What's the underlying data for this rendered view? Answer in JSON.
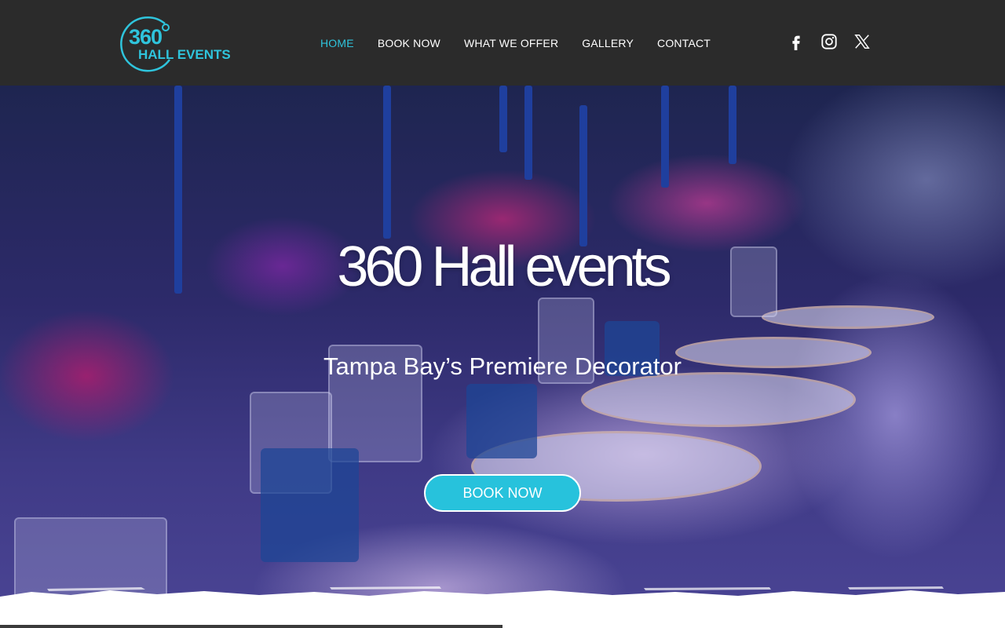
{
  "logo": {
    "number": "360",
    "text": "HALL EVENTS",
    "accent": "#2fc4dc"
  },
  "nav": {
    "items": [
      {
        "label": "HOME",
        "active": true
      },
      {
        "label": "BOOK NOW",
        "active": false
      },
      {
        "label": "WHAT WE OFFER",
        "active": false
      },
      {
        "label": "GALLERY",
        "active": false
      },
      {
        "label": "CONTACT",
        "active": false
      }
    ]
  },
  "social": {
    "icons": [
      "facebook-icon",
      "instagram-icon",
      "x-icon"
    ]
  },
  "hero": {
    "title": "360 Hall events",
    "subtitle": "Tampa Bay’s Premiere Decorator",
    "cta_label": "BOOK NOW"
  },
  "colors": {
    "header_bg": "#2b2b2b",
    "accent": "#27c2dc",
    "text": "#ffffff"
  }
}
